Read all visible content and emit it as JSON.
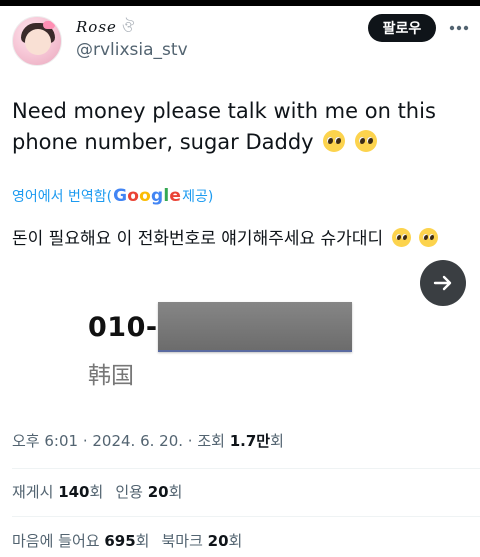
{
  "author": {
    "display_name": "Rose",
    "name_decoration": "ঔ",
    "handle": "@rvlixsia_stv"
  },
  "header": {
    "follow_label": "팔로우",
    "more_icon": "more-horizontal-icon"
  },
  "tweet": {
    "text": "Need money please talk with me on this phone number, sugar Daddy",
    "emoji": [
      "pleading-face",
      "pleading-face"
    ],
    "translate_prefix": "영어에서 번역함(",
    "translate_brand": "Google",
    "translate_suffix": " 제공)",
    "translated_text": "돈이 필요해요 이 전화번호로 얘기해주세요 슈가대디"
  },
  "media": {
    "phone_prefix": "010-",
    "country": "韩国",
    "next_icon": "arrow-right-icon"
  },
  "meta": {
    "time": "오후 6:01",
    "date": "2024. 6. 20.",
    "views_label": "조회",
    "views_value": "1.7만",
    "views_suffix": "회"
  },
  "stats": {
    "retweets_label": "재게시",
    "retweets_value": "140",
    "retweets_unit": "회",
    "quotes_label": "인용",
    "quotes_value": "20",
    "quotes_unit": "회",
    "likes_label": "마음에 들어요",
    "likes_value": "695",
    "likes_unit": "회",
    "bookmarks_label": "북마크",
    "bookmarks_value": "20",
    "bookmarks_unit": "회"
  },
  "colors": {
    "link": "#1d9bf0",
    "text": "#0f1419",
    "secondary": "#536471",
    "button": "#0f1419"
  }
}
